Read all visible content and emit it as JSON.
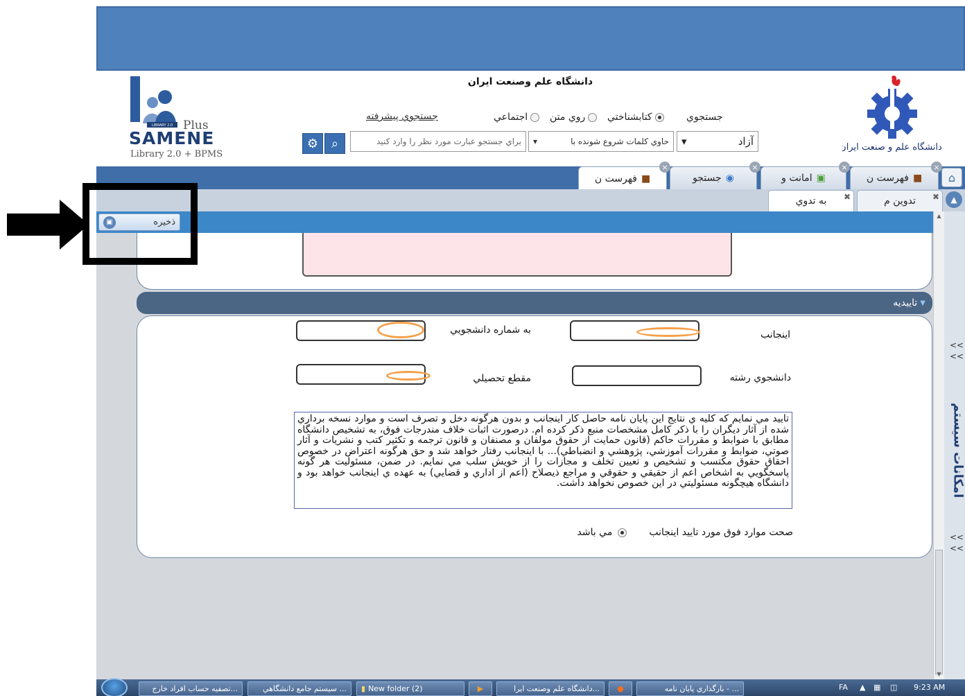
{
  "header": {
    "university_title": "دانشگاه علم وصنعت ايران",
    "logo_right_caption": "دانشگاه علم و صنعت ایران",
    "logo_left": {
      "plus": "Plus",
      "brand": "SAMENE",
      "sub": "Library 2.0 + BPMS",
      "badge": "LIBRARY 2.0"
    }
  },
  "search": {
    "radio_label": "جستجوي",
    "options": [
      "كتابشناختي",
      "روي متن",
      "اجتماعي"
    ],
    "selected": "كتابشناختي",
    "advanced_link": "جستجوي پيشرفته",
    "mode_select": "آزاد",
    "condition_select": "حاوي كلمات شروع شونده با",
    "query_placeholder": "براي جستجو عبارت مورد نظر را وارد كنيد"
  },
  "tabs": [
    {
      "label": "فهرست ن"
    },
    {
      "label": "امانت و"
    },
    {
      "label": "جستجو"
    },
    {
      "label": "فهرست ن"
    }
  ],
  "subtabs": [
    {
      "label": "تدوين م"
    },
    {
      "label": "به تدوي"
    }
  ],
  "toolbar": {
    "save_label": "ذخيره"
  },
  "section": {
    "title": "تاييديه"
  },
  "form": {
    "student_label": "اينجانب",
    "student_number_label": "به شماره دانشجويي",
    "major_label": "دانشجوي رشته",
    "degree_label": "مقطع تحصيلي"
  },
  "terms_text": "تاييد مي نمايم كه كليه ي نتايج اين پايان نامه حاصل كار اينجانب و بدون هرگونه دخل و تصرف است و موارد نسخه برداري شده از آثار ديگران را با ذكر كامل مشخصات منبع ذكر كرده ام. درصورت اثبات خلاف مندرجات فوق، به تشخيص دانشگاه مطابق با ضوابط و مقررات حاكم (قانون حمايت از حقوق مولفان و مصنفان و قانون ترجمه و تكثير كتب و نشريات و آثار صوتي، ضوابط و مقررات آموزشي، پژوهشي و انضباطي)... با اينجانب رفتار خواهد شد و حق هرگونه اعتراض در خصوص احقاق حقوق مكتسب و تشخيص و تعيين تخلف و مجازات را از خويش سلب مي نمايم. در ضمن، مسئوليت هر گونه پاسخگويي به اشخاص اعم از حقيقي و حقوقي و مراجع ذيصلاح (اعم از اداري و قضايي) به عهده ي اينجانب خواهد بود و دانشگاه هيچگونه مسئوليتي در اين خصوص نخواهد داشت.",
  "confirm": {
    "label": "صحت موارد فوق مورد تاييد اينجانب",
    "option": "مي باشد"
  },
  "side_rail": {
    "title": "امكانات سيستم",
    "arrows_top": "<<\n<<",
    "arrows_bottom": "<<\n<<"
  },
  "taskbar": {
    "items": [
      "...تصفيه حساب افراد خارج",
      "... سيستم جامع دانشگاهي",
      "New folder (2)",
      "",
      "...دانشگاه علم وصنعت ايرا",
      "",
      "... - بارگذاري پايان نامه"
    ],
    "lang": "FA",
    "time": "9:23 AM"
  }
}
